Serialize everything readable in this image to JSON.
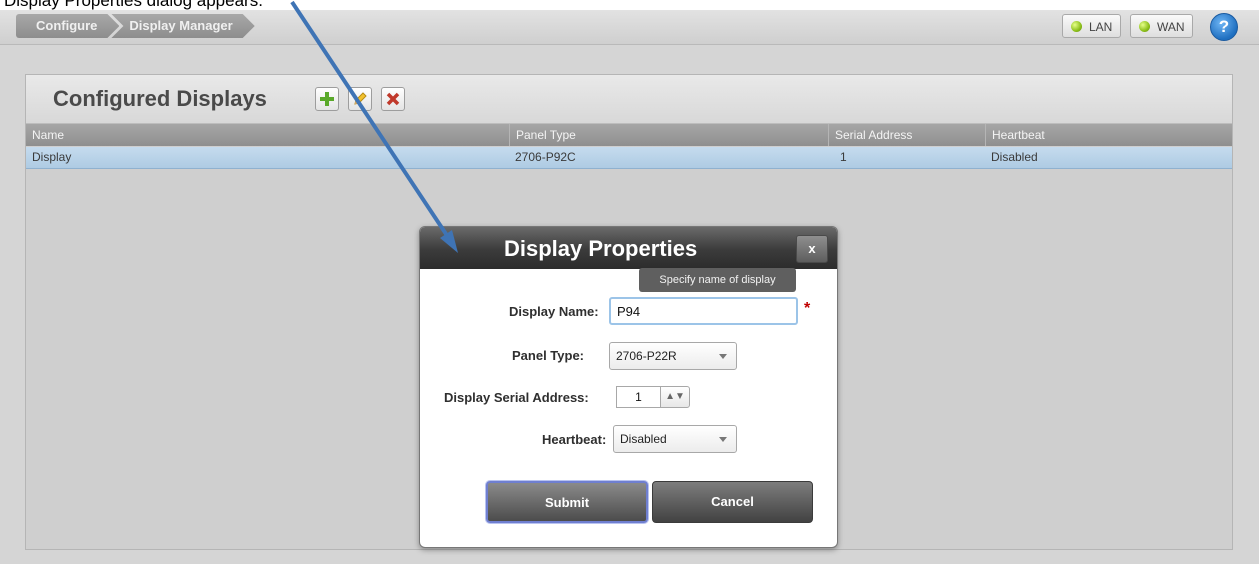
{
  "caption": "Display Properties dialog appears.",
  "breadcrumb": [
    "Configure",
    "Display Manager"
  ],
  "status": {
    "lan_label": "LAN",
    "wan_label": "WAN",
    "led_color": "#8cbf1a"
  },
  "help_label": "?",
  "panel": {
    "title": "Configured Displays",
    "toolbar": {
      "add_icon": "plus-icon",
      "edit_icon": "pencil-icon",
      "delete_icon": "x-icon"
    },
    "columns": [
      "Name",
      "Panel Type",
      "Serial Address",
      "Heartbeat"
    ],
    "rows": [
      {
        "name": "Display",
        "panel_type": "2706-P92C",
        "serial_address": "1",
        "heartbeat": "Disabled"
      }
    ]
  },
  "dialog": {
    "title": "Display Properties",
    "close_label": "x",
    "tooltip": "Specify name of display",
    "display_name_label": "Display Name:",
    "display_name_value": "P94",
    "panel_type_label": "Panel Type:",
    "panel_type_value": "2706-P22R",
    "serial_label": "Display Serial Address:",
    "serial_value": "1",
    "heartbeat_label": "Heartbeat:",
    "heartbeat_value": "Disabled",
    "submit_label": "Submit",
    "cancel_label": "Cancel"
  },
  "colors": {
    "selected_row": "#b7d2e9",
    "arrow": "#3f74b5",
    "required": "#c00000"
  }
}
